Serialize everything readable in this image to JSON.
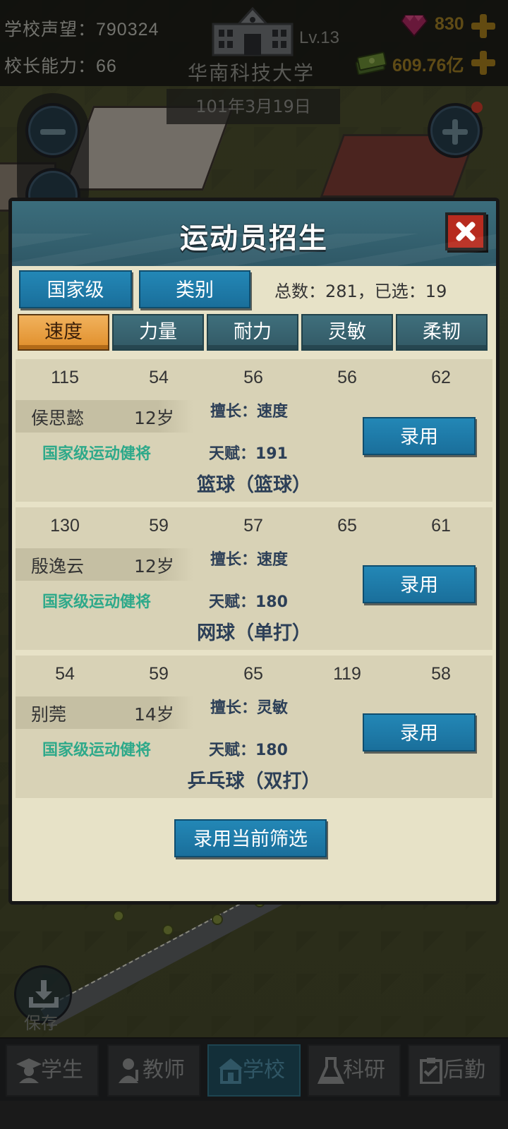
{
  "top_bar": {
    "reputation": "学校声望：790324",
    "ability": "校长能力：66",
    "level": "Lv.13",
    "school_name": "华南科技大学",
    "date": "101年3月19日",
    "gems": "830",
    "money": "609.76亿",
    "icons": [
      "school-building-icon",
      "gem-icon",
      "money-icon",
      "plus-icon"
    ]
  },
  "modal": {
    "title": "运动员招生",
    "filters": [
      "国家级",
      "类别"
    ],
    "totals": "总数：281，已选：19",
    "tabs": [
      {
        "label": "速度",
        "active": true
      },
      {
        "label": "力量",
        "active": false
      },
      {
        "label": "耐力",
        "active": false
      },
      {
        "label": "灵敏",
        "active": false
      },
      {
        "label": "柔韧",
        "active": false
      }
    ],
    "athletes": [
      {
        "stats": [
          "115",
          "54",
          "56",
          "56",
          "62"
        ],
        "name": "侯思懿",
        "age": "12岁",
        "rank": "国家级运动健将",
        "specialty": "擅长：速度",
        "talent": "天赋：191",
        "sport": "篮球（篮球）",
        "hire_label": "录用"
      },
      {
        "stats": [
          "130",
          "59",
          "57",
          "65",
          "61"
        ],
        "name": "殷逸云",
        "age": "12岁",
        "rank": "国家级运动健将",
        "specialty": "擅长：速度",
        "talent": "天赋：180",
        "sport": "网球（单打）",
        "hire_label": "录用"
      },
      {
        "stats": [
          "54",
          "59",
          "65",
          "119",
          "58"
        ],
        "name": "别莞",
        "age": "14岁",
        "rank": "国家级运动健将",
        "specialty": "擅长：灵敏",
        "talent": "天赋：180",
        "sport": "乒乓球（双打）",
        "hire_label": "录用"
      }
    ],
    "hire_all_label": "录用当前筛选"
  },
  "save_label": "保存",
  "bottom_nav": [
    {
      "label": "学生",
      "icon": "student-icon",
      "active": false
    },
    {
      "label": "教师",
      "icon": "teacher-icon",
      "active": false
    },
    {
      "label": "学校",
      "icon": "school-icon",
      "active": true
    },
    {
      "label": "科研",
      "icon": "flask-icon",
      "active": false
    },
    {
      "label": "后勤",
      "icon": "clipboard-icon",
      "active": false
    }
  ],
  "colors": {
    "accent_blue": "#1f7fae",
    "active_tab": "#e9a040",
    "rank_green": "#2ea98a",
    "close_red": "#b72b1f"
  }
}
